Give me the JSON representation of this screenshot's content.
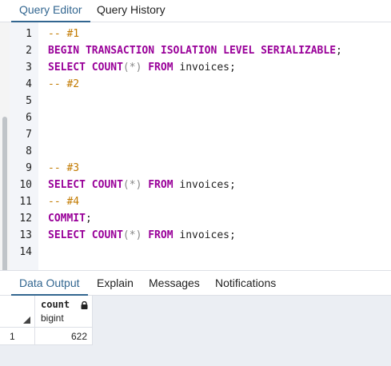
{
  "editor_tabs": [
    "Query Editor",
    "Query History"
  ],
  "editor": {
    "lines": [
      {
        "num": "1",
        "tokens": [
          {
            "t": "cm",
            "v": "-- #1"
          }
        ]
      },
      {
        "num": "2",
        "tokens": [
          {
            "t": "kw",
            "v": "BEGIN TRANSACTION ISOLATION LEVEL SERIALIZABLE"
          },
          {
            "t": "id",
            "v": ";"
          }
        ]
      },
      {
        "num": "3",
        "tokens": [
          {
            "t": "kw",
            "v": "SELECT COUNT"
          },
          {
            "t": "op",
            "v": "(*)"
          },
          {
            "t": "id",
            "v": " "
          },
          {
            "t": "kw",
            "v": "FROM"
          },
          {
            "t": "id",
            "v": " invoices;"
          }
        ]
      },
      {
        "num": "4",
        "tokens": [
          {
            "t": "cm",
            "v": "-- #2"
          }
        ]
      },
      {
        "num": "5",
        "tokens": []
      },
      {
        "num": "6",
        "tokens": []
      },
      {
        "num": "7",
        "tokens": []
      },
      {
        "num": "8",
        "tokens": []
      },
      {
        "num": "9",
        "tokens": [
          {
            "t": "cm",
            "v": "-- #3"
          }
        ]
      },
      {
        "num": "10",
        "tokens": [
          {
            "t": "kw",
            "v": "SELECT COUNT"
          },
          {
            "t": "op",
            "v": "(*)"
          },
          {
            "t": "id",
            "v": " "
          },
          {
            "t": "kw",
            "v": "FROM"
          },
          {
            "t": "id",
            "v": " invoices;"
          }
        ]
      },
      {
        "num": "11",
        "tokens": [
          {
            "t": "cm",
            "v": "-- #4"
          }
        ]
      },
      {
        "num": "12",
        "tokens": [
          {
            "t": "kw",
            "v": "COMMIT"
          },
          {
            "t": "id",
            "v": ";"
          }
        ]
      },
      {
        "num": "13",
        "tokens": [
          {
            "t": "kw",
            "v": "SELECT COUNT"
          },
          {
            "t": "op",
            "v": "(*)"
          },
          {
            "t": "id",
            "v": " "
          },
          {
            "t": "kw",
            "v": "FROM"
          },
          {
            "t": "id",
            "v": " invoices;"
          }
        ]
      },
      {
        "num": "14",
        "tokens": []
      }
    ]
  },
  "output_tabs": [
    "Data Output",
    "Explain",
    "Messages",
    "Notifications"
  ],
  "result_grid": {
    "column_name": "count",
    "column_type": "bigint",
    "rows": [
      {
        "row_number": "1",
        "value": "622"
      }
    ]
  },
  "colors": {
    "accent": "#326690",
    "keyword": "#990099",
    "comment": "#c27a00"
  }
}
